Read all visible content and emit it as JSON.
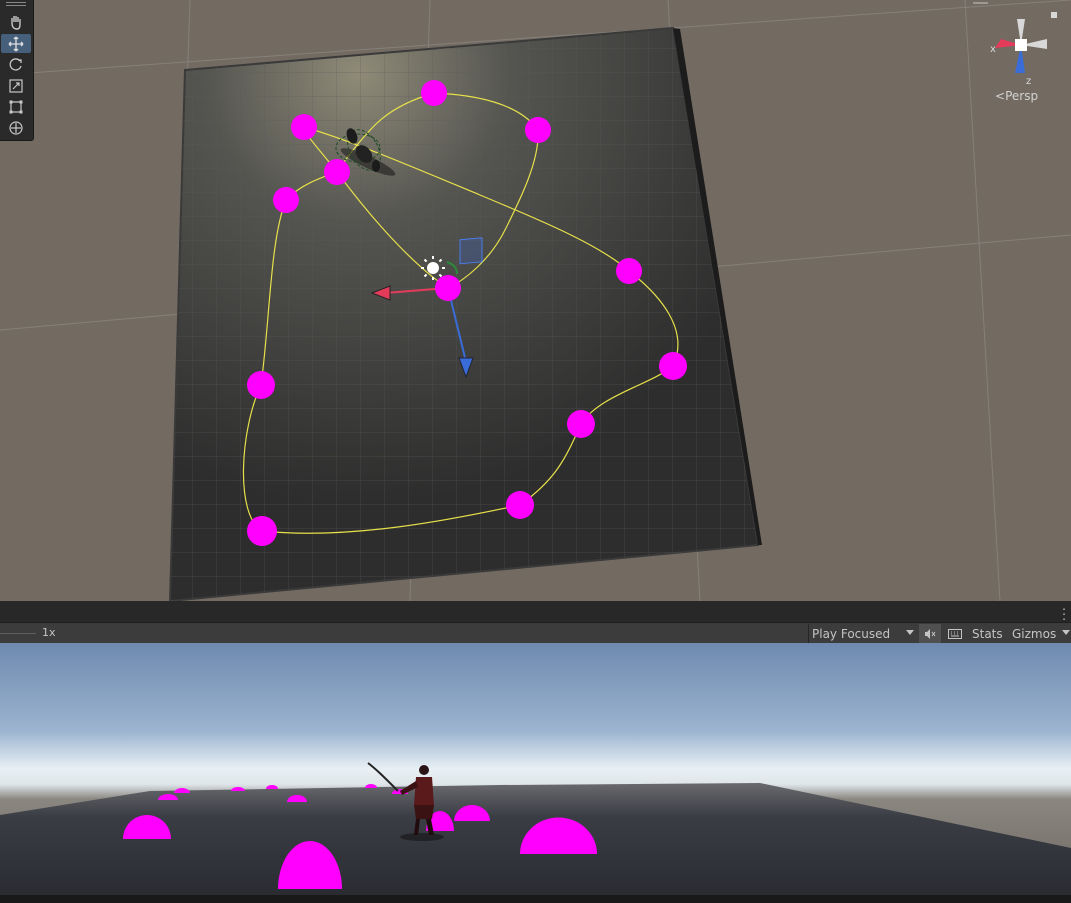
{
  "scene_view": {
    "camera_mode": "Persp",
    "axis_labels": {
      "x": "x",
      "z": "z"
    },
    "tools": [
      {
        "name": "hand-tool",
        "active": false
      },
      {
        "name": "move-tool",
        "active": true
      },
      {
        "name": "rotate-tool",
        "active": false
      },
      {
        "name": "scale-tool",
        "active": false
      },
      {
        "name": "rect-tool",
        "active": false
      },
      {
        "name": "transform-tool",
        "active": false
      }
    ],
    "colors": {
      "background": "#736b62",
      "ground": "#2d2d2d",
      "marker": "#ff00ff",
      "path": "#e6e04a",
      "axis_x": "#e53b5a",
      "axis_z": "#3a6cd8"
    }
  },
  "game_view": {
    "scale_label": "1x",
    "play_mode": "Play Focused",
    "stats_label": "Stats",
    "gizmos_label": "Gizmos",
    "icons": [
      "dropdown-arrow-icon",
      "mute-audio-icon",
      "keyboard-shortcuts-icon",
      "kebab-menu-icon"
    ]
  }
}
